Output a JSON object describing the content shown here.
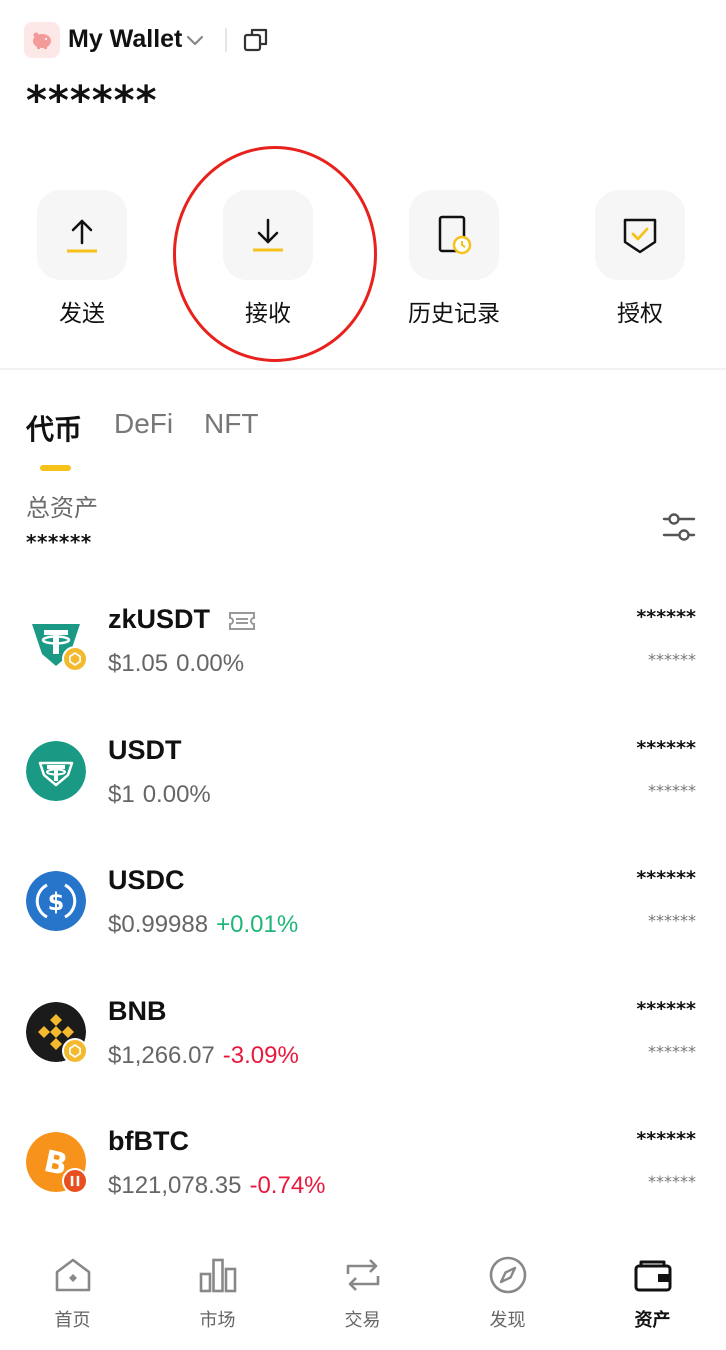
{
  "header": {
    "wallet_name": "My Wallet",
    "balance_masked": "******"
  },
  "actions": [
    {
      "label": "发送",
      "icon": "send-arrow-up-icon"
    },
    {
      "label": "接收",
      "icon": "receive-arrow-down-icon"
    },
    {
      "label": "历史记录",
      "icon": "history-document-clock-icon"
    },
    {
      "label": "授权",
      "icon": "authorize-shield-check-icon"
    }
  ],
  "tabs": [
    {
      "label": "代币",
      "active": true
    },
    {
      "label": "DeFi",
      "active": false
    },
    {
      "label": "NFT",
      "active": false
    }
  ],
  "total": {
    "label": "总资产",
    "value": "******"
  },
  "tokens": [
    {
      "symbol": "zkUSDT",
      "price": "$1.05",
      "change": "0.00%",
      "trend": "neutral",
      "amount": "******",
      "value": "******",
      "logo_color": "#1a9a85",
      "badge": "bnb-chain-badge"
    },
    {
      "symbol": "USDT",
      "price": "$1",
      "change": "0.00%",
      "trend": "neutral",
      "amount": "******",
      "value": "******",
      "logo_color": "#1a9a85"
    },
    {
      "symbol": "USDC",
      "price": "$0.99988",
      "change": "+0.01%",
      "trend": "up",
      "amount": "******",
      "value": "******",
      "logo_color": "#2775ca"
    },
    {
      "symbol": "BNB",
      "price": "$1,266.07",
      "change": "-3.09%",
      "trend": "down",
      "amount": "******",
      "value": "******",
      "logo_color": "#1b1b1b",
      "badge": "bnb-chain-badge"
    },
    {
      "symbol": "bfBTC",
      "price": "$121,078.35",
      "change": "-0.74%",
      "trend": "down",
      "amount": "******",
      "value": "******",
      "logo_color": "#f7931a",
      "badge": "bifrost-badge"
    }
  ],
  "bottom_nav": [
    {
      "label": "首页",
      "icon": "home-icon",
      "active": false
    },
    {
      "label": "市场",
      "icon": "market-bar-chart-icon",
      "active": false
    },
    {
      "label": "交易",
      "icon": "trade-swap-icon",
      "active": false
    },
    {
      "label": "发现",
      "icon": "discover-compass-icon",
      "active": false
    },
    {
      "label": "资产",
      "icon": "assets-wallet-icon",
      "active": true
    }
  ],
  "colors": {
    "accent": "#f6c21a",
    "up": "#1fb679",
    "down": "#e8193c",
    "highlight_ring": "#e8211d"
  }
}
